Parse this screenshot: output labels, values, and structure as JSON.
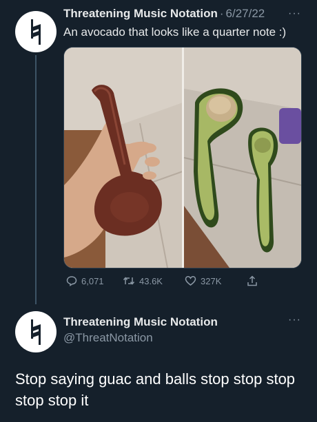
{
  "tweet1": {
    "author_name": "Threatening Music Notation",
    "separator": "·",
    "date": "6/27/22",
    "more": "···",
    "text": "An avocado that looks like a quarter note :)",
    "stats": {
      "replies": "6,071",
      "retweets": "43.6K",
      "likes": "327K"
    }
  },
  "tweet2": {
    "author_name": "Threatening Music Notation",
    "handle": "@ThreatNotation",
    "more": "···",
    "text": "Stop saying guac and balls stop stop stop stop stop it"
  },
  "icons": {
    "avatar": "natural-sign-icon",
    "reply": "reply-icon",
    "retweet": "retweet-icon",
    "like": "heart-icon",
    "share": "share-icon",
    "more": "more-icon"
  },
  "colors": {
    "background": "#15202b",
    "muted": "#8b98a5",
    "text": "#e7e9ea",
    "thread_line": "#3d5466"
  }
}
